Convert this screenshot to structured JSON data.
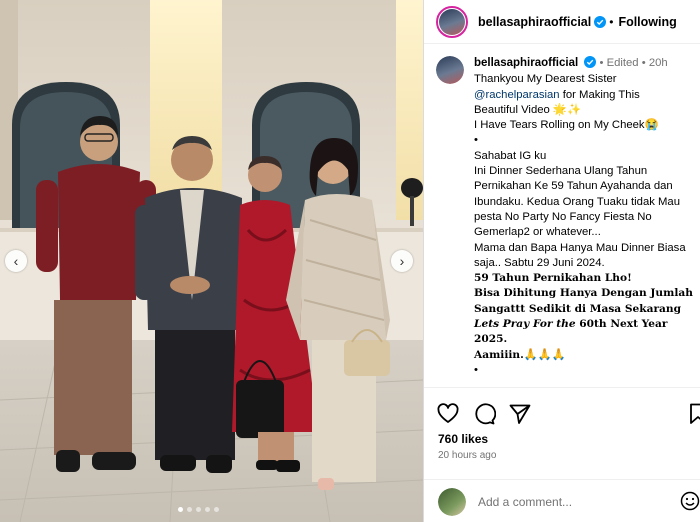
{
  "post": {
    "username": "bellasaphiraofficial",
    "follow_status": "Following",
    "edited_label": "Edited",
    "time_ago": "20h"
  },
  "caption": {
    "lines": [
      "Thankyou My Dearest Sister",
      "@rachelparasian",
      " for Making This",
      "Beautiful Video 🌟✨",
      "I Have Tears Rolling on My Cheek😭",
      "•",
      "Sahabat IG ku",
      "Ini Dinner Sederhana Ulang Tahun Pernikahan Ke 59 Tahun Ayahanda dan Ibundaku. Kedua Orang Tuaku tidak Mau pesta No Party No Fancy Fiesta No Gemerlap2 or whatever...",
      "Mama dan Bapa Hanya Mau Dinner Biasa saja.. Sabtu 29 Juni 2024.",
      "59 Tahun Pernikahan Lho!",
      "Bisa Dihitung Hanya Dengan Jumlah Sangattt Sedikit di Masa Sekarang",
      "Lets Pray For the",
      " 60th Next Year 2025.",
      "Aamiiin.",
      "🙏🙏🙏",
      "•"
    ]
  },
  "engagement": {
    "likes": "760 likes",
    "posted": "20 hours ago"
  },
  "comment_box": {
    "placeholder": "Add a comment..."
  },
  "icons": {
    "like": "heart-icon",
    "comment": "comment-icon",
    "share": "send-icon",
    "save": "bookmark-icon",
    "emoji": "emoji-icon",
    "verified": "verified-badge-icon",
    "prev": "chevron-left-icon",
    "next": "chevron-right-icon"
  },
  "colors": {
    "verified": "#0095f6",
    "mention": "#00376b",
    "meta": "#737373",
    "story_ring": "#d6249f"
  }
}
